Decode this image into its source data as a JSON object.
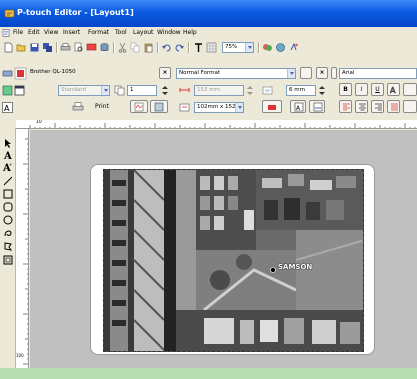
{
  "window": {
    "title": "P-touch Editor - [Layout1]"
  },
  "menu": {
    "items": [
      "File",
      "Edit",
      "View",
      "Insert",
      "Format",
      "Tool",
      "Layout",
      "Window",
      "Help"
    ]
  },
  "toolbar": {
    "zoom": "75%",
    "print_label": "Print"
  },
  "printer": {
    "name": "Brother QL-1050",
    "mode": "Standard",
    "copies": "1"
  },
  "format": {
    "style": "Normal Format",
    "length": "153 mm",
    "margin": "6 mm",
    "paper": "102mm x 152r"
  },
  "font": {
    "name": "Arial"
  },
  "annotation": {
    "text": "SAMSON"
  },
  "ruler": {
    "h_mark": "10",
    "v_mark": "100"
  },
  "icons": {
    "app": "ptouch-icon",
    "doc": "document-icon"
  },
  "colors": {
    "titlebar": "#0a5ae0",
    "background": "#b5ddb0",
    "canvas": "#c0c0c0"
  }
}
